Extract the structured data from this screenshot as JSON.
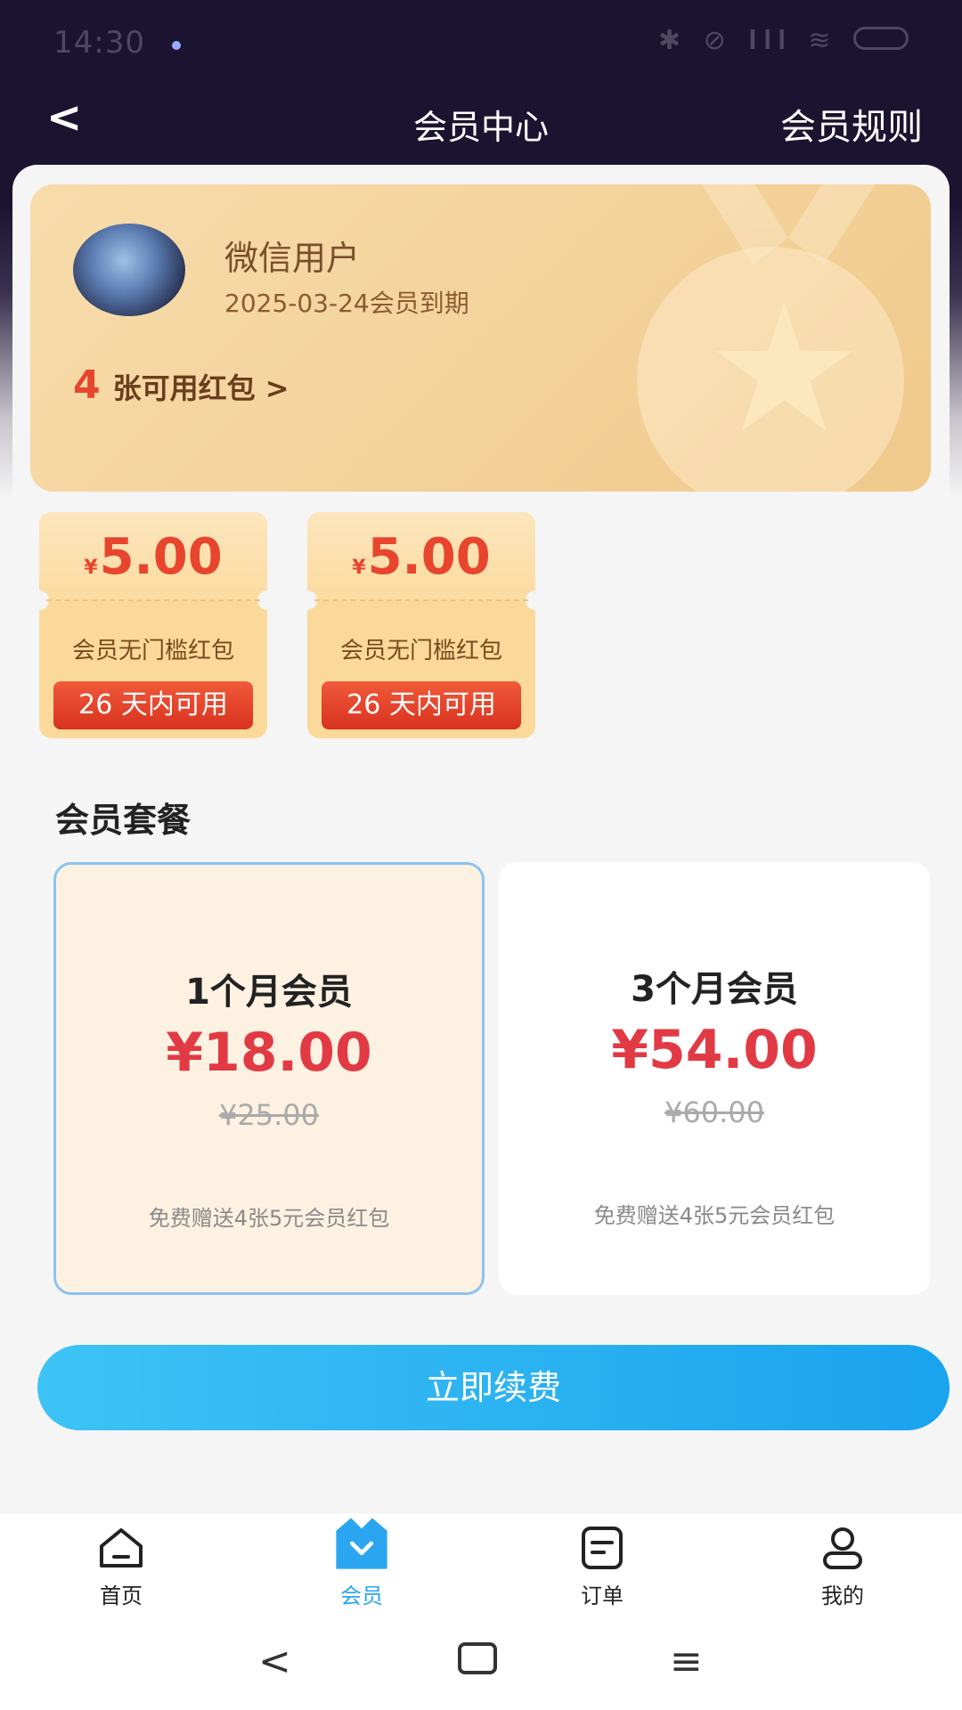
{
  "status_bar": {
    "time": "14:30",
    "icons": "✱ ⊘ 𝐈𝐥𝐥 ≋",
    "battery": "100"
  },
  "nav": {
    "title": "会员中心",
    "rules_label": "会员规则"
  },
  "member": {
    "name": "微信用户",
    "expire": "2025-03-24会员到期",
    "coupon_count": "4",
    "coupon_text": "张可用红包 >"
  },
  "coupons": [
    {
      "currency": "¥",
      "amount": "5.00",
      "title": "会员无门槛红包",
      "days": "26 天内可用"
    },
    {
      "currency": "¥",
      "amount": "5.00",
      "title": "会员无门槛红包",
      "days": "26 天内可用"
    }
  ],
  "plans_title": "会员套餐",
  "plans": [
    {
      "name": "1个月会员",
      "price": "¥18.00",
      "original": "¥25.00",
      "note": "免费赠送4张5元会员红包",
      "selected": true
    },
    {
      "name": "3个月会员",
      "price": "¥54.00",
      "original": "¥60.00",
      "note": "免费赠送4张5元会员红包",
      "selected": false
    }
  ],
  "renew_label": "立即续费",
  "tabs": [
    {
      "label": "首页",
      "icon": "home-icon"
    },
    {
      "label": "会员",
      "icon": "vip-icon",
      "active": true
    },
    {
      "label": "订单",
      "icon": "order-icon"
    },
    {
      "label": "我的",
      "icon": "profile-icon"
    }
  ],
  "accent": "#2aa6f0"
}
